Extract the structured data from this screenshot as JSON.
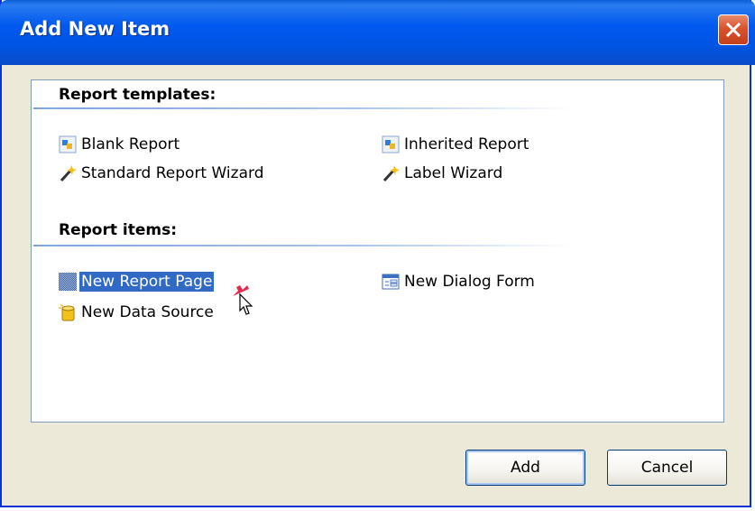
{
  "window": {
    "title": "Add New Item"
  },
  "sections": {
    "templates": {
      "header": "Report templates:",
      "items": [
        {
          "label": "Blank Report",
          "icon": "blank-report-icon"
        },
        {
          "label": "Inherited Report",
          "icon": "inherited-report-icon"
        },
        {
          "label": "Standard Report Wizard",
          "icon": "wizard-wand-icon"
        },
        {
          "label": "Label Wizard",
          "icon": "wizard-wand-icon"
        }
      ]
    },
    "report_items": {
      "header": "Report items:",
      "items": [
        {
          "label": "New Report Page",
          "icon": "report-page-icon",
          "selected": true
        },
        {
          "label": "New Dialog Form",
          "icon": "dialog-form-icon"
        },
        {
          "label": "New Data Source",
          "icon": "data-source-icon"
        }
      ]
    }
  },
  "buttons": {
    "add": "Add",
    "cancel": "Cancel"
  },
  "colors": {
    "titlebar": "#0054e3",
    "selection": "#316ac5",
    "close": "#d9532d",
    "dialog_bg": "#ece9d8"
  }
}
